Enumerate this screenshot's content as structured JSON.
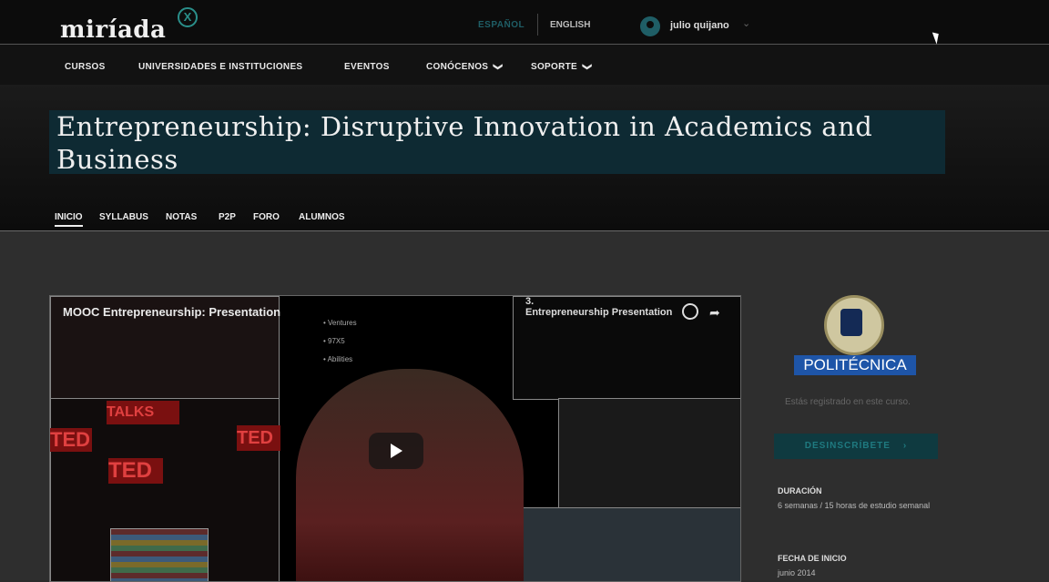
{
  "header": {
    "logo": "miríada",
    "logo_badge": "X",
    "lang_active": "ESPAÑOL",
    "lang_other": "ENGLISH",
    "user_name": "julio quijano",
    "user_chevron": "⌄"
  },
  "nav": {
    "items": [
      {
        "label": "CURSOS"
      },
      {
        "label": "UNIVERSIDADES E INSTITUCIONES"
      },
      {
        "label": "EVENTOS"
      },
      {
        "label": "CONÓCENOS",
        "has_dropdown": true
      },
      {
        "label": "SOPORTE",
        "has_dropdown": true
      }
    ],
    "chevron": "❯"
  },
  "course": {
    "title": "Entrepreneurship: Disruptive Innovation in Academics and Business",
    "tabs": [
      {
        "label": "INICIO",
        "active": true
      },
      {
        "label": "SYLLABUS"
      },
      {
        "label": "NOTAS"
      },
      {
        "label": "P2P"
      },
      {
        "label": "FORO"
      },
      {
        "label": "ALUMNOS"
      }
    ]
  },
  "video": {
    "title": "MOOC Entrepreneurship: Presentation",
    "right_title": "Entrepreneurship Presentation",
    "number": "3.",
    "bullets": [
      "• Ventures",
      "• 97X5",
      "• Abilities"
    ],
    "ted_label": "TED",
    "talks_label": "TALKS"
  },
  "sidebar": {
    "university": "POLITÉCNICA",
    "registered_text": "Estás registrado en este curso.",
    "unsubscribe_label": "DESINSCRÍBETE",
    "unsubscribe_arrow": "›",
    "duration_label": "DURACIÓN",
    "duration_value": "6 semanas / 15 horas de estudio semanal",
    "start_label": "FECHA DE INICIO",
    "start_value": "junio 2014"
  },
  "colors": {
    "accent_teal": "#1f5e66",
    "university_blue": "#1e55a8"
  }
}
